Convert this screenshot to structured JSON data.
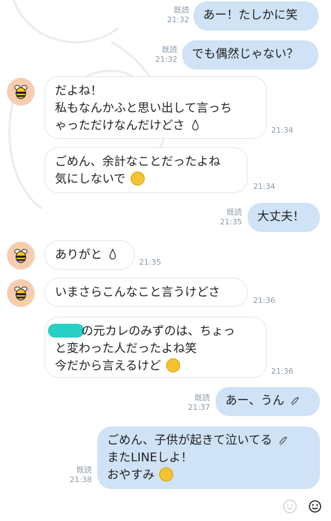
{
  "read_label": "既読",
  "messages": [
    {
      "side": "sent",
      "time": "21:32",
      "read": true,
      "lines": [
        "あー！たしかに笑"
      ]
    },
    {
      "side": "sent",
      "time": "21:32",
      "read": true,
      "lines": [
        "でも偶然じゃない？"
      ]
    },
    {
      "side": "recv",
      "time": "21:34",
      "avatar": true,
      "lines": [
        "だよね！",
        "私もなんかふと思い出して言っち",
        "ゃっただけなんだけどさ"
      ]
    },
    {
      "side": "recv",
      "time": "21:34",
      "avatar": false,
      "lines": [
        "ごめん、余計なことだったよね",
        "気にしないで"
      ]
    },
    {
      "side": "sent",
      "time": "21:35",
      "read": true,
      "lines": [
        "大丈夫！"
      ]
    },
    {
      "side": "recv",
      "time": "21:35",
      "avatar": true,
      "lines": [
        "ありがと"
      ]
    },
    {
      "side": "recv",
      "time": "21:36",
      "avatar": true,
      "lines": [
        "いまさらこんなこと言うけどさ"
      ]
    },
    {
      "side": "recv",
      "time": "21:36",
      "avatar": false,
      "lines": [
        "の元カレのみずのは、ちょっ",
        "と変わった人だったよね笑",
        "今だから言えるけど"
      ]
    },
    {
      "side": "sent",
      "time": "21:37",
      "read": true,
      "lines": [
        "あー、うん"
      ]
    },
    {
      "side": "sent",
      "time": "21:38",
      "read": true,
      "lines": [
        "ごめん、子供が起きて泣いてる",
        "またLINEしよ！",
        "おやすみ"
      ]
    }
  ],
  "icons": {
    "avatar": "bee-icon",
    "bottom": [
      "emoji-smile-icon",
      "sticker-face-icon"
    ]
  },
  "colors": {
    "sent_bubble": "#cfe2f6",
    "recv_bubble": "#ffffff",
    "meta_text": "#8a98a8",
    "avatar_bg": "#f7cdb0"
  }
}
